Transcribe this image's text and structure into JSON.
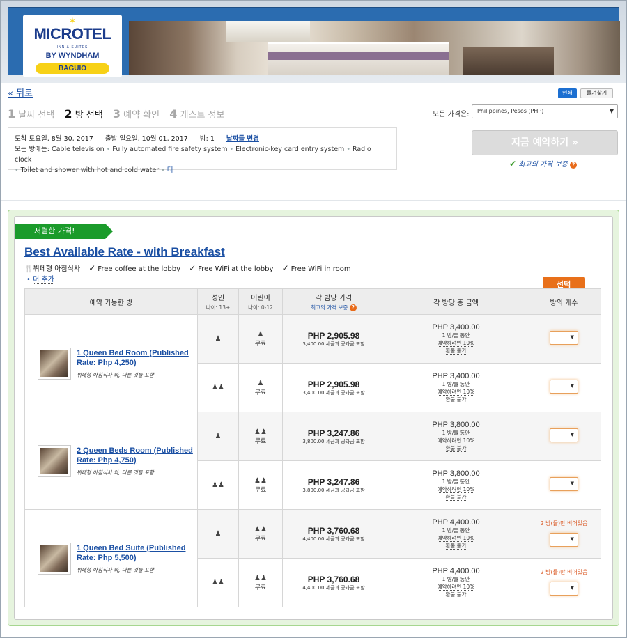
{
  "brand": {
    "name": "MICROTEL",
    "sub": "INN & SUITES",
    "by": "BY WYNDHAM",
    "city": "BAGUIO"
  },
  "nav": {
    "back": "« 뒤로",
    "print": "인쇄",
    "favorite": "즐겨찾기"
  },
  "steps": [
    {
      "num": "1",
      "label": "날짜 선택"
    },
    {
      "num": "2",
      "label": "방 선택"
    },
    {
      "num": "3",
      "label": "예약 확인"
    },
    {
      "num": "4",
      "label": "게스트 정보"
    }
  ],
  "currency": {
    "label": "모든 가격은:",
    "value": "Philippines, Pesos (PHP)"
  },
  "stay": {
    "arrival": "도착 토요일, 8월 30, 2017",
    "departure": "출발 일요일, 10월 01, 2017",
    "nights": "밤: 1",
    "change_dates": "날짜들 변경",
    "amenities_label": "모든 방에는:",
    "amenities": [
      "Cable television",
      "Fully automated fire safety system",
      "Electronic-key card entry system",
      "Radio clock",
      "Toilet and shower with hot and cold water"
    ],
    "more": "더"
  },
  "book_now": "지금 예약하기 »",
  "best_rate_guarantee": "최고의 가격 보증",
  "rate": {
    "ribbon": "저렴한 가격!",
    "title": "Best Available Rate - with Breakfast",
    "features": [
      "뷔페형 아침식사",
      "Free coffee at the lobby",
      "Free WiFi at the lobby",
      "Free WiFi in room"
    ],
    "more": "더 추가",
    "select": "선택"
  },
  "table": {
    "headers": {
      "room": "예약 가능한 방",
      "adults": "성인",
      "adults_sub": "나이: 13+",
      "children": "어린이",
      "children_sub": "나이: 0-12",
      "nightly": "각 밤당 가격",
      "nightly_sub": "최고의 가격 보증",
      "total": "각 방당 총 금액",
      "qty": "방의 개수"
    },
    "free_label": "무료",
    "per_label": "1 방/들 동안",
    "deposit_label": "예약하려면 10%",
    "refund_label": "환불 불가",
    "rooms": [
      {
        "name": "1 Queen Bed Room (Published Rate: Php 4,250)",
        "sub": "뷔페형 아침식사 와, 다른 것들 포함",
        "rows": [
          {
            "nightly": "PHP 2,905.98",
            "nightly_sub": "3,400.00 세금과 공과금 포함",
            "total": "PHP 3,400.00",
            "avail": ""
          },
          {
            "nightly": "PHP 2,905.98",
            "nightly_sub": "3,400.00 세금과 공과금 포함",
            "total": "PHP 3,400.00",
            "avail": ""
          }
        ]
      },
      {
        "name": "2 Queen Beds Room (Published Rate: Php 4,750)",
        "sub": "뷔페형 아침식사 와, 다른 것들 포함",
        "rows": [
          {
            "nightly": "PHP 3,247.86",
            "nightly_sub": "3,800.00 세금과 공과금 포함",
            "total": "PHP 3,800.00",
            "avail": ""
          },
          {
            "nightly": "PHP 3,247.86",
            "nightly_sub": "3,800.00 세금과 공과금 포함",
            "total": "PHP 3,800.00",
            "avail": ""
          }
        ]
      },
      {
        "name": "1 Queen Bed Suite (Published Rate: Php 5,500)",
        "sub": "뷔페형 아침식사 와, 다른 것들 포함",
        "rows": [
          {
            "nightly": "PHP 3,760.68",
            "nightly_sub": "4,400.00 세금과 공과금 포함",
            "total": "PHP 4,400.00",
            "avail": "2 방(들)만 비어있음"
          },
          {
            "nightly": "PHP 3,760.68",
            "nightly_sub": "4,400.00 세금과 공과금 포함",
            "total": "PHP 4,400.00",
            "avail": "2 방(들)만 비어있음"
          }
        ]
      }
    ]
  }
}
